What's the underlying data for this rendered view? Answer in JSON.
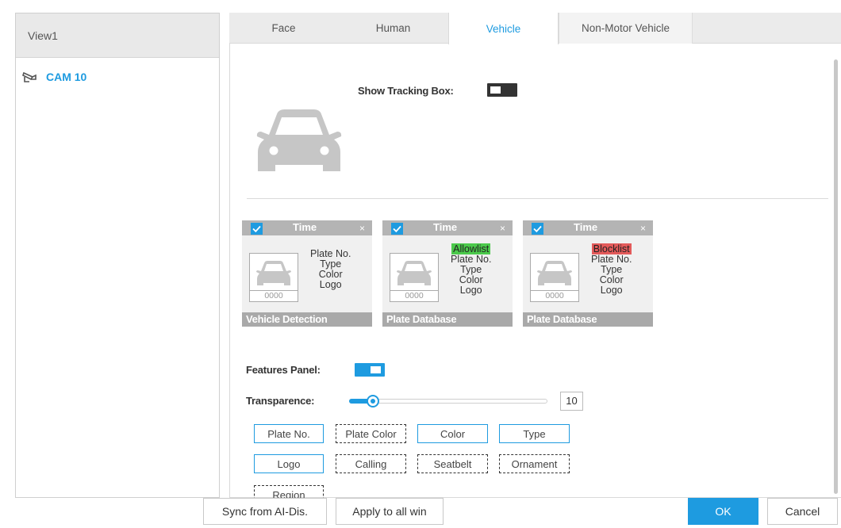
{
  "left": {
    "header": "View1",
    "camera": "CAM 10"
  },
  "tabs": [
    {
      "label": "Face"
    },
    {
      "label": "Human"
    },
    {
      "label": "Vehicle"
    },
    {
      "label": "Non-Motor Vehicle"
    }
  ],
  "active_tab": "Vehicle",
  "vehicle": {
    "show_tracking_box_label": "Show Tracking Box:",
    "show_tracking_box_state": "off",
    "features_panel_label": "Features Panel:",
    "features_panel_state": "on",
    "transparence_label": "Transparence:",
    "transparence_value": "10"
  },
  "cards": [
    {
      "time": "Time",
      "close": "×",
      "plate_num": "0000",
      "tag": "",
      "lines": [
        "Plate No.",
        "Type",
        "Color",
        "Logo"
      ],
      "footer": "Vehicle Detection"
    },
    {
      "time": "Time",
      "close": "×",
      "plate_num": "0000",
      "tag": "Allowlist",
      "lines": [
        "Plate No.",
        "Type",
        "Color",
        "Logo"
      ],
      "footer": "Plate Database"
    },
    {
      "time": "Time",
      "close": "×",
      "plate_num": "0000",
      "tag": "Blocklist",
      "lines": [
        "Plate No.",
        "Type",
        "Color",
        "Logo"
      ],
      "footer": "Plate Database"
    }
  ],
  "features": [
    {
      "label": "Plate No.",
      "selected": true
    },
    {
      "label": "Plate Color",
      "selected": false
    },
    {
      "label": "Color",
      "selected": true
    },
    {
      "label": "Type",
      "selected": true
    },
    {
      "label": "Logo",
      "selected": true
    },
    {
      "label": "Calling",
      "selected": false
    },
    {
      "label": "Seatbelt",
      "selected": false
    },
    {
      "label": "Ornament",
      "selected": false
    },
    {
      "label": "Region",
      "selected": false
    }
  ],
  "buttons": {
    "sync": "Sync from AI-Dis.",
    "apply_all": "Apply to all win",
    "ok": "OK",
    "cancel": "Cancel"
  },
  "colors": {
    "accent": "#1e9be0",
    "allowlist": "#4bc94b",
    "blocklist": "#e35a5a"
  }
}
